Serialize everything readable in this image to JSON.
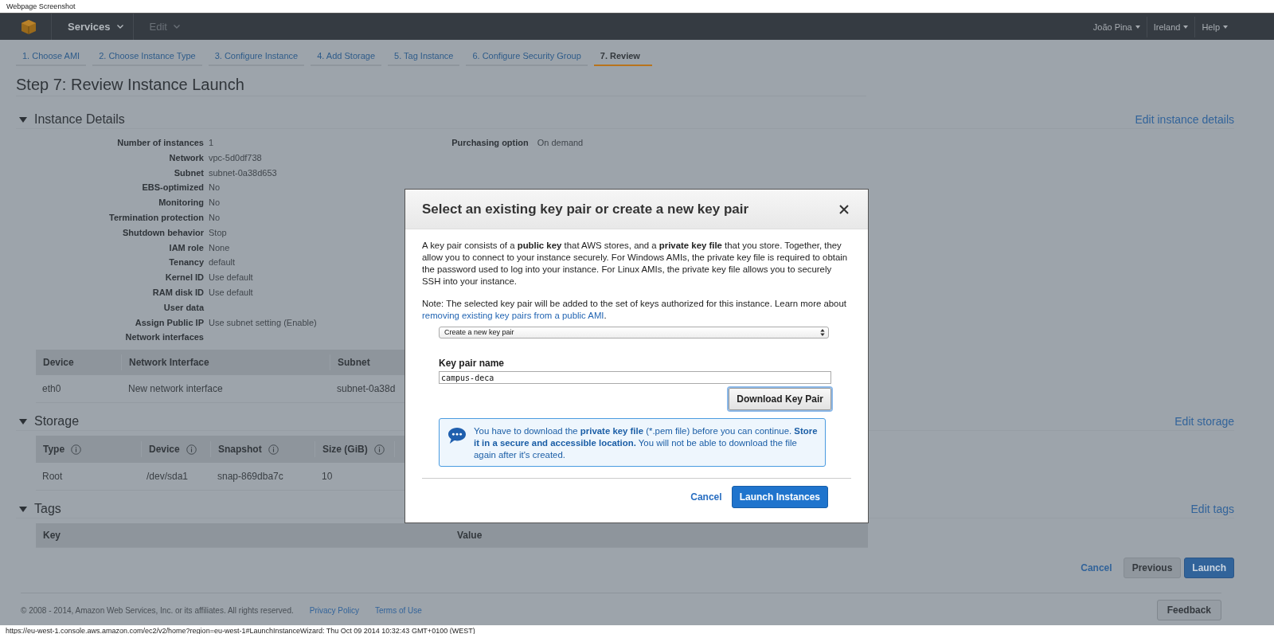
{
  "caption": "Webpage Screenshot",
  "nav": {
    "menus": [
      {
        "label": "Services",
        "disabled": false
      },
      {
        "label": "Edit",
        "disabled": true
      }
    ],
    "right_menus": [
      {
        "label": "João Pina"
      },
      {
        "label": "Ireland"
      },
      {
        "label": "Help"
      }
    ]
  },
  "steps": [
    {
      "label": "1. Choose AMI",
      "selected": false
    },
    {
      "label": "2. Choose Instance Type",
      "selected": false
    },
    {
      "label": "3. Configure Instance",
      "selected": false
    },
    {
      "label": "4. Add Storage",
      "selected": false
    },
    {
      "label": "5. Tag Instance",
      "selected": false
    },
    {
      "label": "6. Configure Security Group",
      "selected": false
    },
    {
      "label": "7. Review",
      "selected": true
    }
  ],
  "title": "Step 7: Review Instance Launch",
  "instance_details": {
    "title": "Instance Details",
    "expanded": true,
    "edit_link": "Edit instance details",
    "details": [
      {
        "label": "Number of instances",
        "value": "1"
      },
      {
        "label": "Network",
        "value": "vpc-5d0df738"
      },
      {
        "label": "Subnet",
        "value": "subnet-0a38d653"
      },
      {
        "label": "EBS-optimized",
        "value": "No"
      },
      {
        "label": "Monitoring",
        "value": "No"
      },
      {
        "label": "Termination protection",
        "value": "No"
      },
      {
        "label": "Shutdown behavior",
        "value": "Stop"
      },
      {
        "label": "IAM role",
        "value": "None"
      },
      {
        "label": "Tenancy",
        "value": "default"
      },
      {
        "label": "Kernel ID",
        "value": "Use default"
      },
      {
        "label": "RAM disk ID",
        "value": "Use default"
      },
      {
        "label": "User data"
      },
      {
        "label": "Assign Public IP",
        "value": "Use subnet setting (Enable)"
      },
      {
        "label": "Network interfaces"
      }
    ],
    "details_right": [
      {
        "label": "Purchasing option",
        "value": "On demand"
      }
    ],
    "table": {
      "columns": [
        {
          "label": "Device",
          "info": false
        },
        {
          "label": "Network Interface",
          "info": false
        },
        {
          "label": "Subnet",
          "info": false
        }
      ],
      "rows": [
        [
          "eth0",
          "New network interface",
          "subnet-0a38d"
        ]
      ]
    }
  },
  "storage": {
    "title": "Storage",
    "expanded": true,
    "edit_link": "Edit storage",
    "table": {
      "columns": [
        {
          "label": "Type",
          "info": true
        },
        {
          "label": "Device",
          "info": true
        },
        {
          "label": "Snapshot",
          "info": true
        },
        {
          "label": "Size (GiB)",
          "info": true
        }
      ],
      "rows": [
        [
          "Root",
          "/dev/sda1",
          "snap-869dba7c",
          "10"
        ]
      ]
    }
  },
  "tags": {
    "title": "Tags",
    "expanded": true,
    "edit_link": "Edit tags",
    "table": {
      "columns": [
        {
          "label": "Key",
          "info": false
        },
        {
          "label": "Value",
          "info": false
        }
      ]
    }
  },
  "actions": {
    "cancel": "Cancel",
    "previous": "Previous",
    "launch": "Launch"
  },
  "footer": {
    "copyright": "© 2008 - 2014, Amazon Web Services, Inc. or its affiliates. All rights reserved.",
    "links": [
      "Privacy Policy",
      "Terms of Use"
    ],
    "feedback": "Feedback"
  },
  "status_url": "https://eu-west-1.console.aws.amazon.com/ec2/v2/home?region=eu-west-1#LaunchInstanceWizard: Thu Oct 09 2014 10:32:43 GMT+0100 (WEST)",
  "modal": {
    "title": "Select an existing key pair or create a new key pair",
    "intro": "A key pair consists of a **public key** that AWS stores, and a **private key file** that you store. Together, they allow you to connect to your instance securely. For Windows AMIs, the private key file is required to obtain the password used to log into your instance. For Linux AMIs, the private key file allows you to securely SSH into your instance.",
    "note": "Note: The selected key pair will be added to the set of keys authorized for this instance. Learn more about",
    "note_link": "removing existing key pairs from a public AMI",
    "note_end": ".",
    "select": {
      "value": "Create a new key pair"
    },
    "key_name_label": "Key pair name",
    "key_name": {
      "value": "campus-deca"
    },
    "download": "Download Key Pair",
    "info": "You have to download the **private key file** (*.pem file) before you can continue. **Store it in a secure and accessible location.** You will not be able to download the file again after it's created.",
    "cancel": "Cancel",
    "launch": "Launch Instances"
  }
}
